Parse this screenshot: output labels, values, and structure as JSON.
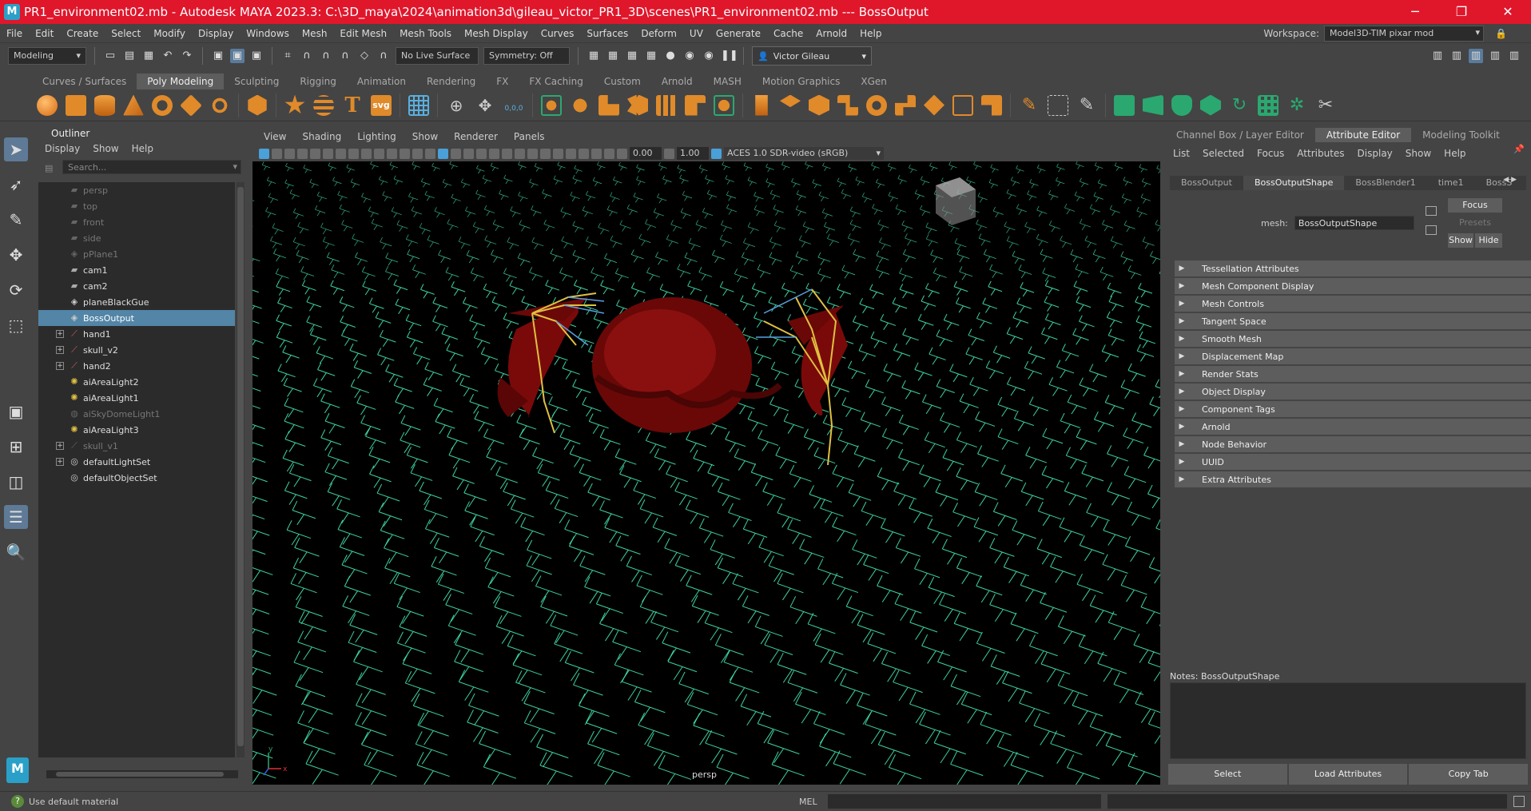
{
  "window": {
    "title": "PR1_environment02.mb - Autodesk MAYA 2023.3: C:\\3D_maya\\2024\\animation3d\\gileau_victor_PR1_3D\\scenes\\PR1_environment02.mb   ---   BossOutput",
    "app_icon": "M",
    "minimize": "─",
    "maximize": "❐",
    "close": "✕"
  },
  "menubar": {
    "items": [
      "File",
      "Edit",
      "Create",
      "Select",
      "Modify",
      "Display",
      "Windows",
      "Mesh",
      "Edit Mesh",
      "Mesh Tools",
      "Mesh Display",
      "Curves",
      "Surfaces",
      "Deform",
      "UV",
      "Generate",
      "Cache",
      "Arnold",
      "Help"
    ],
    "workspace_label": "Workspace:",
    "workspace_value": "Model3D-TIM pixar mod"
  },
  "statusline": {
    "mode": "Modeling",
    "live_surface": "No Live Surface",
    "symmetry": "Symmetry: Off",
    "user": "Victor Gileau"
  },
  "shelf": {
    "tabs": [
      "Curves / Surfaces",
      "Poly Modeling",
      "Sculpting",
      "Rigging",
      "Animation",
      "Rendering",
      "FX",
      "FX Caching",
      "Custom",
      "Arnold",
      "MASH",
      "Motion Graphics",
      "XGen"
    ],
    "active_tab": "Poly Modeling",
    "icon_colors": [
      "#e88a2a",
      "#e88a2a",
      "#e88a2a",
      "#e88a2a",
      "#e88a2a",
      "#e88a2a",
      "#e88a2a",
      "#e88a2a",
      "#e88a2a",
      "#4a90c8",
      "#3aa0c8",
      "#58b0e0",
      "#e88a2a",
      "#e88a2a",
      "#e88a2a",
      "#e88a2a",
      "#e88a2a",
      "#e88a2a",
      "#e88a2a",
      "#e88a2a",
      "#e88a2a",
      "#e88a2a",
      "#e88a2a",
      "#e88a2a",
      "#e88a2a",
      "#e88a2a",
      "#e88a2a",
      "#e88a2a",
      "#2aa870",
      "#2aa870",
      "#2aa870",
      "#2aa870",
      "#2aa870",
      "#2aa870",
      "#2aa870",
      "#2aa870"
    ],
    "svg_label": "svg",
    "text_label": "T",
    "uv_label": "0,0,0"
  },
  "outliner": {
    "title": "Outliner",
    "menu": [
      "Display",
      "Show",
      "Help"
    ],
    "search_placeholder": "Search...",
    "items": [
      {
        "label": "persp",
        "icon": "camera-icon",
        "dim": true,
        "expand": false
      },
      {
        "label": "top",
        "icon": "camera-icon",
        "dim": true,
        "expand": false
      },
      {
        "label": "front",
        "icon": "camera-icon",
        "dim": true,
        "expand": false
      },
      {
        "label": "side",
        "icon": "camera-icon",
        "dim": true,
        "expand": false
      },
      {
        "label": "pPlane1",
        "icon": "mesh-icon",
        "dim": true,
        "expand": false
      },
      {
        "label": "cam1",
        "icon": "camera-icon",
        "dim": false,
        "expand": false
      },
      {
        "label": "cam2",
        "icon": "camera-icon",
        "dim": false,
        "expand": false
      },
      {
        "label": "planeBlackGue",
        "icon": "mesh-icon",
        "dim": false,
        "expand": false
      },
      {
        "label": "BossOutput",
        "icon": "mesh-icon",
        "dim": false,
        "expand": false,
        "selected": true
      },
      {
        "label": "hand1",
        "icon": "joint-icon",
        "dim": false,
        "expand": true
      },
      {
        "label": "skull_v2",
        "icon": "joint-icon",
        "dim": false,
        "expand": true
      },
      {
        "label": "hand2",
        "icon": "joint-icon",
        "dim": false,
        "expand": true
      },
      {
        "label": "aiAreaLight2",
        "icon": "light-icon",
        "dim": false,
        "expand": false
      },
      {
        "label": "aiAreaLight1",
        "icon": "light-icon",
        "dim": false,
        "expand": false
      },
      {
        "label": "aiSkyDomeLight1",
        "icon": "skydome-icon",
        "dim": true,
        "expand": false
      },
      {
        "label": "aiAreaLight3",
        "icon": "light-icon",
        "dim": false,
        "expand": false
      },
      {
        "label": "skull_v1",
        "icon": "joint-icon",
        "dim": true,
        "expand": true
      },
      {
        "label": "defaultLightSet",
        "icon": "set-icon",
        "dim": false,
        "expand": true
      },
      {
        "label": "defaultObjectSet",
        "icon": "set-icon",
        "dim": false,
        "expand": false
      }
    ]
  },
  "viewport": {
    "menu": [
      "View",
      "Shading",
      "Lighting",
      "Show",
      "Renderer",
      "Panels"
    ],
    "exposure": "0.00",
    "gamma": "1.00",
    "color_space": "ACES 1.0 SDR-video (sRGB)",
    "camera_label": "persp",
    "axis_y": "y",
    "axis_x": "x"
  },
  "attribute_editor": {
    "panel_tabs": [
      "Channel Box / Layer Editor",
      "Attribute Editor",
      "Modeling Toolkit"
    ],
    "active_panel_tab": "Attribute Editor",
    "menu": [
      "List",
      "Selected",
      "Focus",
      "Attributes",
      "Display",
      "Show",
      "Help"
    ],
    "node_tabs": [
      "BossOutput",
      "BossOutputShape",
      "BossBlender1",
      "time1",
      "BossS"
    ],
    "active_node_tab": "BossOutputShape",
    "mesh_label": "mesh:",
    "mesh_value": "BossOutputShape",
    "focus": "Focus",
    "presets": "Presets",
    "show": "Show",
    "hide": "Hide",
    "sections": [
      "Tessellation Attributes",
      "Mesh Component Display",
      "Mesh Controls",
      "Tangent Space",
      "Smooth Mesh",
      "Displacement Map",
      "Render Stats",
      "Object Display",
      "Component Tags",
      "Arnold",
      "Node Behavior",
      "UUID",
      "Extra Attributes"
    ],
    "notes_label": "Notes:  BossOutputShape",
    "buttons": [
      "Select",
      "Load Attributes",
      "Copy Tab"
    ]
  },
  "statusbar": {
    "help_text": "Use default material",
    "mel_label": "MEL"
  },
  "colors": {
    "title_bar": "#e0162b",
    "selection": "#5285a6",
    "grid_wire": "#44e8b0",
    "mesh_red": "#7a0a0a"
  }
}
